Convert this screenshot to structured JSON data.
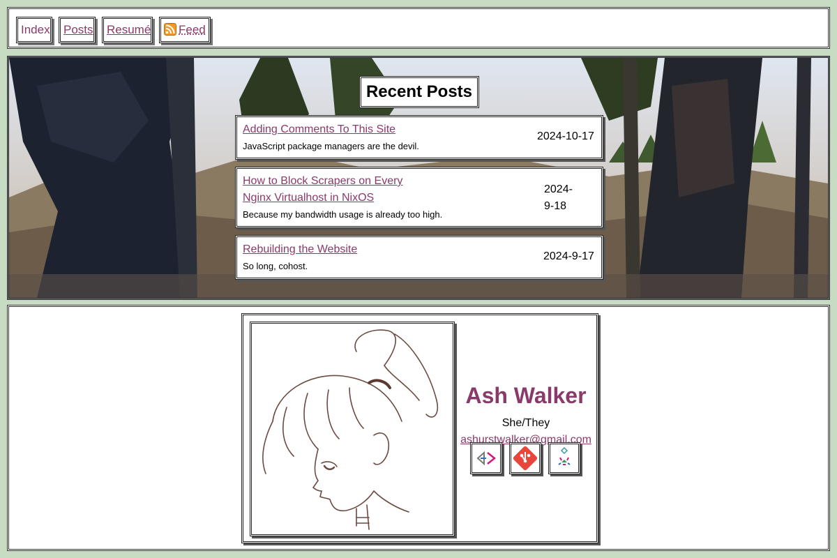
{
  "nav": {
    "items": [
      {
        "label": "Index"
      },
      {
        "label": "Posts"
      },
      {
        "label": "Resumé"
      },
      {
        "label": "Feed",
        "icon": "rss-feed-icon"
      }
    ]
  },
  "recent": {
    "title": "Recent Posts",
    "posts": [
      {
        "title": "Adding Comments To This Site",
        "desc": "JavaScript package managers are the devil.",
        "date": "2024-10-17"
      },
      {
        "title_line1": "How to Block Scrapers on Every",
        "title_line2": "Nginx Virtualhost in NixOS",
        "desc": "Because my bandwidth usage is already too high.",
        "date_line1": "2024-",
        "date_line2": "9-18"
      },
      {
        "title": "Rebuilding the Website",
        "desc": "So long, cohost.",
        "date": "2024-9-17"
      }
    ]
  },
  "profile": {
    "name": "Ash Walker",
    "pronouns": "She/They",
    "email": "ashurstwalker@gmail.com",
    "links": [
      {
        "icon": "bracket-arrows-icon"
      },
      {
        "icon": "git-icon",
        "color": "#e8453c"
      },
      {
        "icon": "sparkle-icon"
      }
    ]
  },
  "colors": {
    "link": "#8a3a6a",
    "background": "#c8dcc4"
  }
}
